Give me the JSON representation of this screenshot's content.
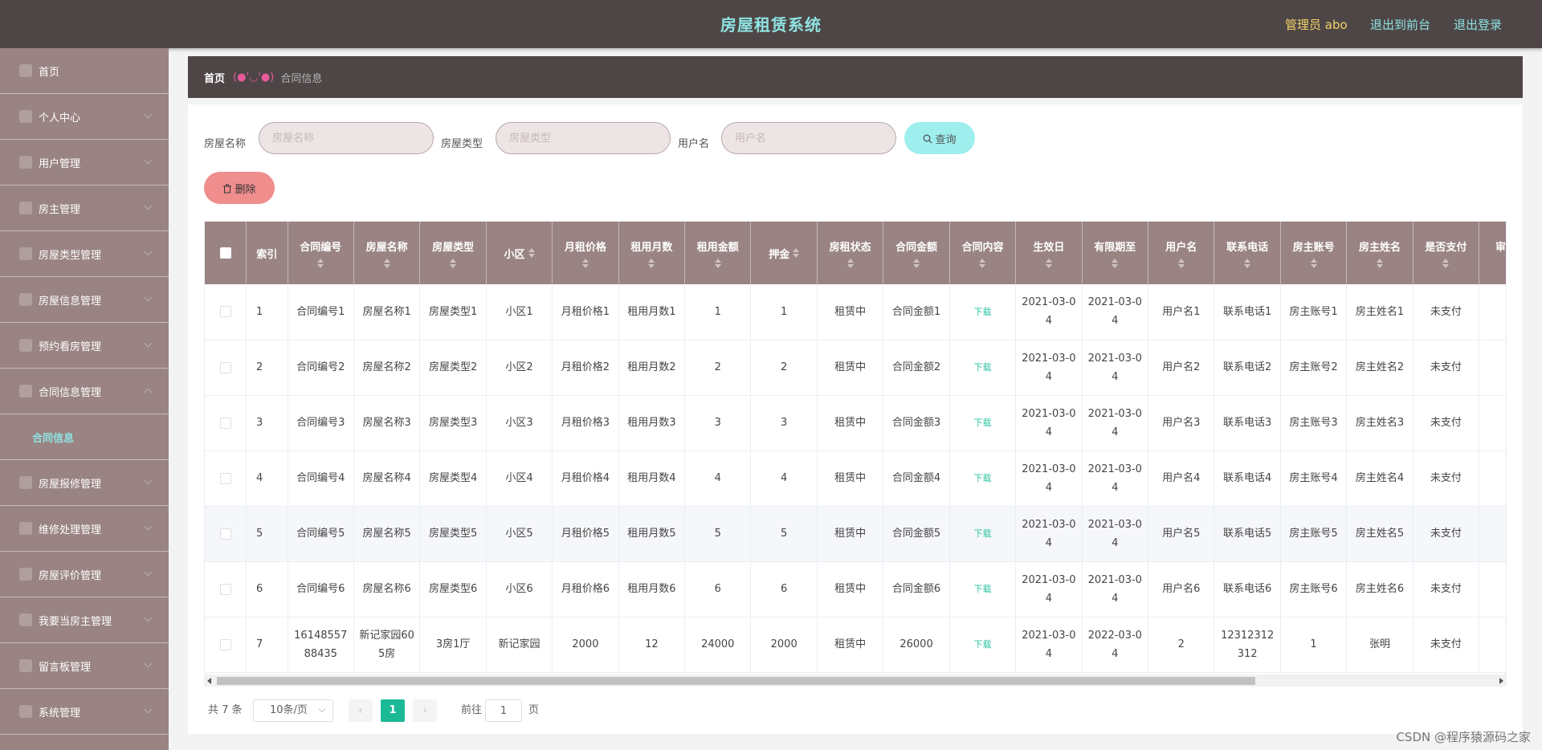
{
  "header": {
    "title": "房屋租赁系统",
    "admin": "管理员 abo",
    "to_front": "退出到前台",
    "logout": "退出登录"
  },
  "sidebar": {
    "items": [
      {
        "label": "首页"
      },
      {
        "label": "个人中心"
      },
      {
        "label": "用户管理"
      },
      {
        "label": "房主管理"
      },
      {
        "label": "房屋类型管理"
      },
      {
        "label": "房屋信息管理"
      },
      {
        "label": "预约看房管理"
      },
      {
        "label": "合同信息管理"
      },
      {
        "label": "房屋报修管理"
      },
      {
        "label": "维修处理管理"
      },
      {
        "label": "房屋评价管理"
      },
      {
        "label": "我要当房主管理"
      },
      {
        "label": "留言板管理"
      },
      {
        "label": "系统管理"
      }
    ],
    "active_sub": "合同信息"
  },
  "breadcrumb": {
    "home": "首页",
    "face": "(●'◡'●)",
    "current": "合同信息"
  },
  "search": {
    "house_name_label": "房屋名称",
    "house_name_placeholder": "房屋名称",
    "house_type_label": "房屋类型",
    "house_type_placeholder": "房屋类型",
    "username_label": "用户名",
    "username_placeholder": "用户名",
    "query_label": "查询",
    "delete_label": "删除"
  },
  "table": {
    "columns": [
      "索引",
      "合同编号",
      "房屋名称",
      "房屋类型",
      "小区",
      "月租价格",
      "租用月数",
      "租用金额",
      "押金",
      "房租状态",
      "合同金额",
      "合同内容",
      "生效日",
      "有限期至",
      "用户名",
      "联系电话",
      "房主账号",
      "房主姓名",
      "是否支付",
      "审核回复"
    ],
    "rows": [
      [
        "1",
        "合同编号1",
        "房屋名称1",
        "房屋类型1",
        "小区1",
        "月租价格1",
        "租用月数1",
        "1",
        "1",
        "租赁中",
        "合同金额1",
        "下载",
        "2021-03-04",
        "2021-03-04",
        "用户名1",
        "联系电话1",
        "房主账号1",
        "房主姓名1",
        "未支付",
        ""
      ],
      [
        "2",
        "合同编号2",
        "房屋名称2",
        "房屋类型2",
        "小区2",
        "月租价格2",
        "租用月数2",
        "2",
        "2",
        "租赁中",
        "合同金额2",
        "下载",
        "2021-03-04",
        "2021-03-04",
        "用户名2",
        "联系电话2",
        "房主账号2",
        "房主姓名2",
        "未支付",
        ""
      ],
      [
        "3",
        "合同编号3",
        "房屋名称3",
        "房屋类型3",
        "小区3",
        "月租价格3",
        "租用月数3",
        "3",
        "3",
        "租赁中",
        "合同金额3",
        "下载",
        "2021-03-04",
        "2021-03-04",
        "用户名3",
        "联系电话3",
        "房主账号3",
        "房主姓名3",
        "未支付",
        ""
      ],
      [
        "4",
        "合同编号4",
        "房屋名称4",
        "房屋类型4",
        "小区4",
        "月租价格4",
        "租用月数4",
        "4",
        "4",
        "租赁中",
        "合同金额4",
        "下载",
        "2021-03-04",
        "2021-03-04",
        "用户名4",
        "联系电话4",
        "房主账号4",
        "房主姓名4",
        "未支付",
        ""
      ],
      [
        "5",
        "合同编号5",
        "房屋名称5",
        "房屋类型5",
        "小区5",
        "月租价格5",
        "租用月数5",
        "5",
        "5",
        "租赁中",
        "合同金额5",
        "下载",
        "2021-03-04",
        "2021-03-04",
        "用户名5",
        "联系电话5",
        "房主账号5",
        "房主姓名5",
        "未支付",
        ""
      ],
      [
        "6",
        "合同编号6",
        "房屋名称6",
        "房屋类型6",
        "小区6",
        "月租价格6",
        "租用月数6",
        "6",
        "6",
        "租赁中",
        "合同金额6",
        "下载",
        "2021-03-04",
        "2021-03-04",
        "用户名6",
        "联系电话6",
        "房主账号6",
        "房主姓名6",
        "未支付",
        ""
      ],
      [
        "7",
        "1614855788435",
        "新记家园605房",
        "3房1厅",
        "新记家园",
        "2000",
        "12",
        "24000",
        "2000",
        "租赁中",
        "26000",
        "下载",
        "2021-03-04",
        "2022-03-04",
        "2",
        "12312312312",
        "1",
        "张明",
        "未支付",
        ""
      ]
    ]
  },
  "pagination": {
    "total": "共 7 条",
    "page_size": "10条/页",
    "current": "1",
    "goto_label": "前往",
    "goto_value": "1",
    "page_suffix": "页",
    "prev": "‹",
    "next": "›"
  },
  "watermark": "CSDN @程序猿源码之家",
  "colors": {
    "header_bg": "#4e4646",
    "sidebar_bg": "#9a8483",
    "accent_cyan": "#8fe3e3",
    "delete_red": "#f08d8d",
    "query_cyan": "#9eeeee",
    "pager_active": "#1cb997"
  }
}
